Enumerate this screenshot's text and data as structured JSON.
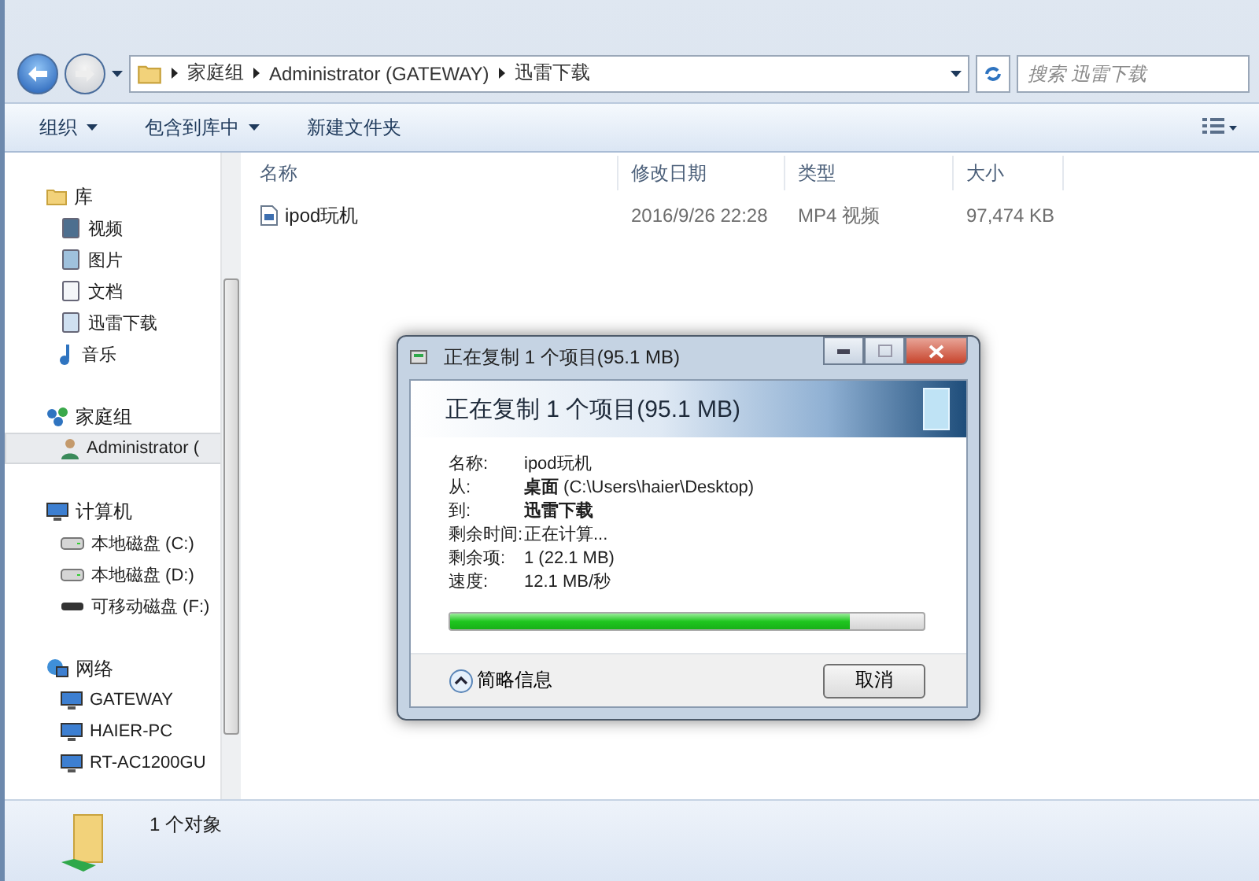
{
  "address": {
    "crumbs": [
      "家庭组",
      "Administrator (GATEWAY)",
      "迅雷下载"
    ],
    "search_placeholder": "搜索 迅雷下载"
  },
  "toolbar": {
    "buttons": [
      {
        "label": "组织",
        "dropdown": true
      },
      {
        "label": "包含到库中",
        "dropdown": true
      },
      {
        "label": "新建文件夹",
        "dropdown": false
      }
    ]
  },
  "sidebar": {
    "groups": [
      {
        "label": "库",
        "children": [
          {
            "label": "视频",
            "selected": false
          },
          {
            "label": "图片",
            "selected": false
          },
          {
            "label": "文档",
            "selected": false
          },
          {
            "label": "迅雷下载",
            "selected": false
          },
          {
            "label": "音乐",
            "selected": false
          }
        ]
      },
      {
        "label": "家庭组",
        "children": [
          {
            "label": "Administrator (",
            "selected": true
          }
        ]
      },
      {
        "label": "计算机",
        "children": [
          {
            "label": "本地磁盘 (C:)",
            "selected": false
          },
          {
            "label": "本地磁盘 (D:)",
            "selected": false
          },
          {
            "label": "可移动磁盘 (F:)",
            "selected": false
          }
        ]
      },
      {
        "label": "网络",
        "children": [
          {
            "label": "GATEWAY",
            "selected": false
          },
          {
            "label": "HAIER-PC",
            "selected": false
          },
          {
            "label": "RT-AC1200GU",
            "selected": false
          }
        ]
      }
    ]
  },
  "table": {
    "columns": [
      "名称",
      "修改日期",
      "类型",
      "大小"
    ],
    "rows": [
      {
        "name": "ipod玩机",
        "modified": "2016/9/26 22:28",
        "type": "MP4 视频",
        "size": "97,474 KB"
      }
    ]
  },
  "status_bar": {
    "text": "1 个对象"
  },
  "dialog": {
    "title": "正在复制 1 个项目(95.1 MB)",
    "heading": "正在复制 1 个项目(95.1 MB)",
    "details": [
      {
        "label": "名称:",
        "value": "ipod玩机",
        "bold": false
      },
      {
        "label": "从:",
        "value": "**桌面** (C:\\Users\\haier\\Desktop)",
        "bold": false
      },
      {
        "label": "到:",
        "value": "迅雷下载",
        "bold": true
      },
      {
        "label": "剩余时间:",
        "value": "正在计算...",
        "bold": false
      },
      {
        "label": "剩余项:",
        "value": "1 (22.1 MB)",
        "bold": false
      },
      {
        "label": "速度:",
        "value": "12.1 MB/秒",
        "bold": false
      }
    ],
    "progress": {
      "level": 0.845
    },
    "more_info": "简略信息",
    "cancel": "取消"
  }
}
